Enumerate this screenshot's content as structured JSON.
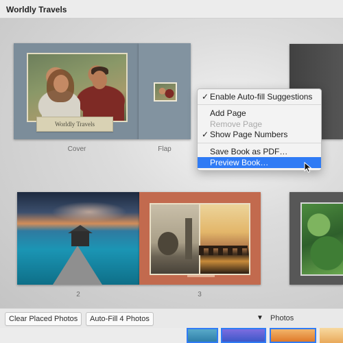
{
  "window": {
    "title": "Worldly Travels"
  },
  "spreads": {
    "cover": {
      "label_text": "Worldly Travels",
      "caption": "Cover"
    },
    "flap": {
      "caption": "Flap"
    },
    "page2": {
      "caption": "2"
    },
    "page3": {
      "caption": "3"
    }
  },
  "context_menu": {
    "items": [
      {
        "label": "Enable Auto-fill Suggestions",
        "checked": true,
        "enabled": true
      },
      {
        "label": "Add Page",
        "checked": false,
        "enabled": true
      },
      {
        "label": "Remove Page",
        "checked": false,
        "enabled": false
      },
      {
        "label": "Show Page Numbers",
        "checked": true,
        "enabled": true
      },
      {
        "label": "Save Book as PDF…",
        "checked": false,
        "enabled": true
      },
      {
        "label": "Preview Book…",
        "checked": false,
        "enabled": true,
        "highlighted": true
      }
    ],
    "checkmark_glyph": "✓",
    "highlight_color": "#2f7bf5"
  },
  "bottombar": {
    "clear_button": "Clear Placed Photos",
    "autofill_button": "Auto-Fill 4 Photos",
    "photos_toggle_glyph": "▼",
    "photos_label": "Photos"
  }
}
